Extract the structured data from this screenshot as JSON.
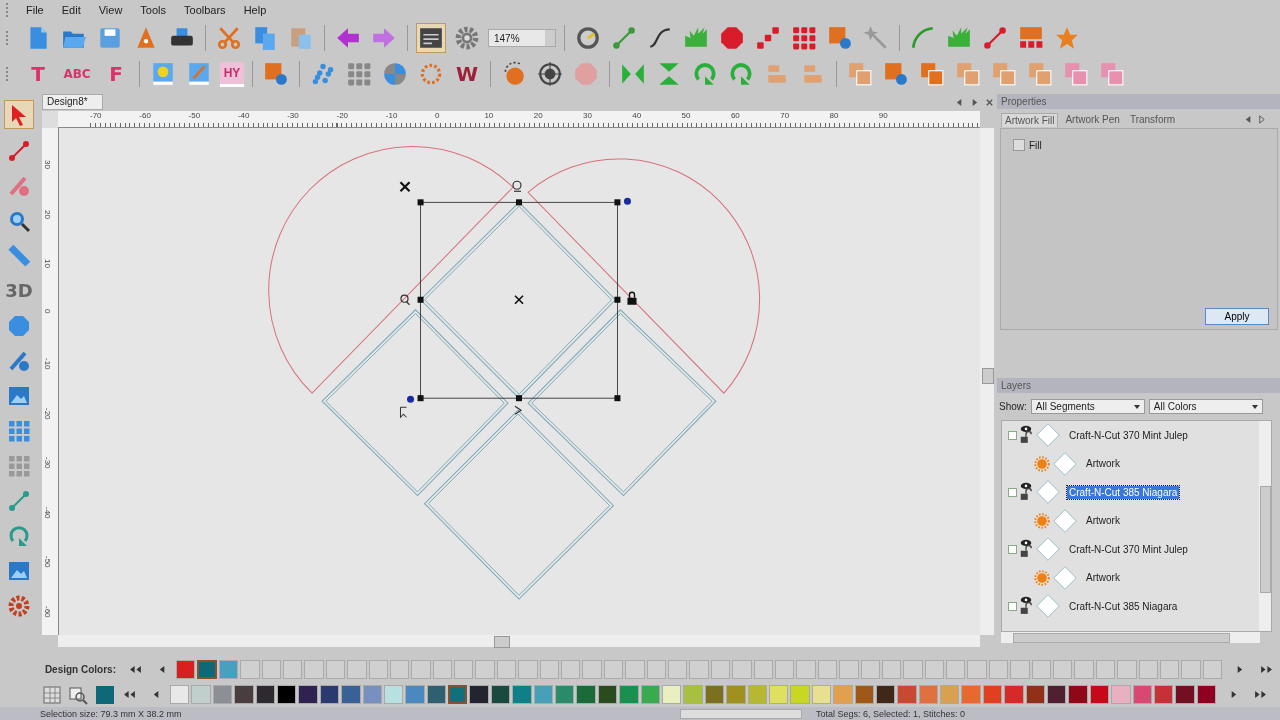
{
  "menu": [
    "File",
    "Edit",
    "View",
    "Tools",
    "Toolbars",
    "Help"
  ],
  "toolbar": {
    "zoom": "147%",
    "glyphs": [
      "T",
      "ABC",
      "F",
      "HY",
      "W"
    ]
  },
  "left_toolbar": {
    "glyphs": [
      "3D"
    ]
  },
  "document_tab": {
    "title": "Design8*"
  },
  "rulers": {
    "horizontal": [
      "-70",
      "-60",
      "-50",
      "-40",
      "-30",
      "-20",
      "-10",
      "0",
      "10",
      "20",
      "30",
      "40",
      "50",
      "60",
      "70",
      "80",
      "90"
    ],
    "vertical": [
      "30",
      "20",
      "10",
      "0",
      "-10",
      "-20",
      "-30",
      "-40",
      "-50",
      "-60"
    ]
  },
  "properties": {
    "title": "Properties",
    "tabs": [
      {
        "label": "Artwork Fill",
        "selected": true
      },
      {
        "label": "Artwork Pen",
        "selected": false
      },
      {
        "label": "Transform",
        "selected": false
      }
    ],
    "fill": {
      "label": "Fill",
      "checked": false
    },
    "apply": "Apply"
  },
  "layers": {
    "title": "Layers",
    "show_label": "Show:",
    "segment_filter": "All Segments",
    "color_filter": "All Colors",
    "items": [
      {
        "name": "Craft-N-Cut 370 Mint Julep",
        "selected": false,
        "children": [
          {
            "name": "Artwork"
          }
        ]
      },
      {
        "name": "Craft-N-Cut 385 Niagara",
        "selected": true,
        "children": [
          {
            "name": "Artwork"
          }
        ]
      },
      {
        "name": "Craft-N-Cut 370 Mint Julep",
        "selected": false,
        "children": [
          {
            "name": "Artwork"
          }
        ]
      },
      {
        "name": "Craft-N-Cut 385 Niagara",
        "selected": false
      }
    ]
  },
  "design_colors": {
    "label": "Design Colors:",
    "colors": [
      {
        "color": "#d82020",
        "selected": false
      },
      {
        "color": "#0e6878",
        "selected": true
      },
      {
        "color": "#48a0c0",
        "selected": false
      }
    ]
  },
  "palette": {
    "colors": [
      {
        "color": "#e8e8e8",
        "selected": false
      },
      {
        "color": "#c0cfcc",
        "selected": false
      },
      {
        "color": "#8c8f96",
        "selected": false
      },
      {
        "color": "#4a3d3e",
        "selected": false
      },
      {
        "color": "#2e2830",
        "selected": false
      },
      {
        "color": "#000000",
        "selected": false
      },
      {
        "color": "#2f2250",
        "selected": false
      },
      {
        "color": "#2a3a70",
        "selected": false
      },
      {
        "color": "#3a6098",
        "selected": false
      },
      {
        "color": "#7890c0",
        "selected": false
      },
      {
        "color": "#b8e0e0",
        "selected": false
      },
      {
        "color": "#4a88c0",
        "selected": false
      },
      {
        "color": "#2e6070",
        "selected": false
      },
      {
        "color": "#0e7278",
        "selected": true
      },
      {
        "color": "#222530",
        "selected": false
      },
      {
        "color": "#184a40",
        "selected": false
      },
      {
        "color": "#0e8088",
        "selected": false
      },
      {
        "color": "#48a0b8",
        "selected": false
      },
      {
        "color": "#2a8a6a",
        "selected": false
      },
      {
        "color": "#1a6a3a",
        "selected": false
      },
      {
        "color": "#2a4a20",
        "selected": false
      },
      {
        "color": "#189050",
        "selected": false
      },
      {
        "color": "#3aaa50",
        "selected": false
      },
      {
        "color": "#e8f0c0",
        "selected": false
      },
      {
        "color": "#a8c040",
        "selected": false
      },
      {
        "color": "#7a7020",
        "selected": false
      },
      {
        "color": "#a09020",
        "selected": false
      },
      {
        "color": "#b8b830",
        "selected": false
      },
      {
        "color": "#e0e060",
        "selected": false
      },
      {
        "color": "#c8d820",
        "selected": false
      },
      {
        "color": "#e8e090",
        "selected": false
      },
      {
        "color": "#e0a050",
        "selected": false
      },
      {
        "color": "#a05818",
        "selected": false
      },
      {
        "color": "#402818",
        "selected": false
      },
      {
        "color": "#c84830",
        "selected": false
      },
      {
        "color": "#e07040",
        "selected": false
      },
      {
        "color": "#d8a050",
        "selected": false
      },
      {
        "color": "#e86830",
        "selected": false
      },
      {
        "color": "#e04020",
        "selected": false
      },
      {
        "color": "#d82828",
        "selected": false
      },
      {
        "color": "#903018",
        "selected": false
      },
      {
        "color": "#502030",
        "selected": false
      },
      {
        "color": "#900818",
        "selected": false
      },
      {
        "color": "#c80818",
        "selected": false
      },
      {
        "color": "#e8b0c0",
        "selected": false
      },
      {
        "color": "#d84870",
        "selected": false
      },
      {
        "color": "#c83038",
        "selected": false
      },
      {
        "color": "#701020",
        "selected": false
      },
      {
        "color": "#900020",
        "selected": false
      }
    ]
  },
  "status_bar": {
    "selection": "Selection size: 79.3 mm X 38.2 mm",
    "totals": "Total Segs: 6, Selected: 1, Stitches: 0"
  }
}
